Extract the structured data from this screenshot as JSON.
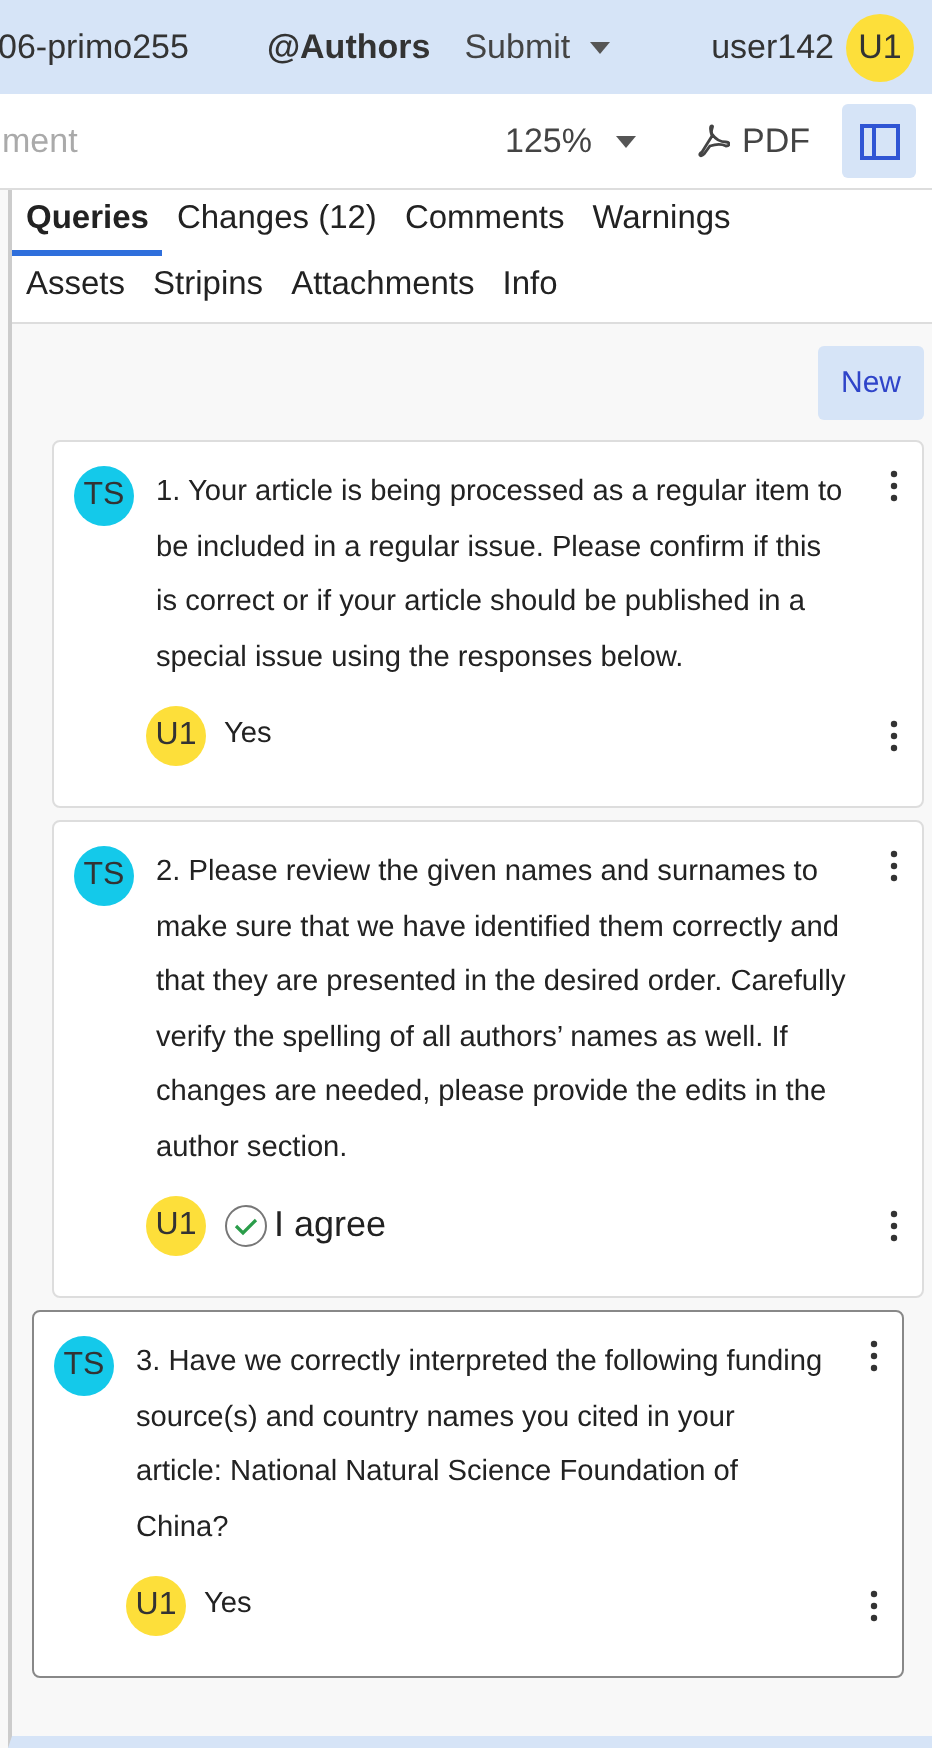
{
  "header": {
    "document": "06-primo255",
    "group": "@Authors",
    "submit": "Submit",
    "user": "user142",
    "avatar": "U1"
  },
  "toolbar": {
    "search": {
      "placeholder": "ment"
    },
    "zoom": "125%",
    "pdf": "PDF",
    "panel_toggle": {
      "on": true
    }
  },
  "tabs": [
    {
      "label": "Queries",
      "selected": true
    },
    {
      "label": "Changes (12)",
      "selected": false
    },
    {
      "label": "Comments",
      "selected": false
    },
    {
      "label": "Warnings",
      "selected": false
    },
    {
      "label": "Assets",
      "selected": false
    },
    {
      "label": "Stripins",
      "selected": false
    },
    {
      "label": "Attachments",
      "selected": false
    },
    {
      "label": "Info",
      "selected": false
    }
  ],
  "new_button": "New",
  "queries": [
    {
      "avatar": "TS",
      "text": "1. Your article is being processed as a regular item to be included in a regular issue. Please confirm if this is correct or if your article should be published in a special issue using the responses below.",
      "selected": false,
      "reply": {
        "kind": "text",
        "avatar": "U1",
        "text": "Yes"
      }
    },
    {
      "avatar": "TS",
      "text": "2. Please review the given names and surnames to make sure that we have identified them correctly and that they are presented in the desired order. Carefully verify the spelling of all authors’ names as well. If changes are needed, please provide the edits in the author section.",
      "selected": false,
      "reply": {
        "kind": "agree",
        "avatar": "U1",
        "text": "I agree"
      }
    },
    {
      "avatar": "TS",
      "text": "3. Have we correctly interpreted the following funding source(s) and country names you cited in your article: National Natural Science Foundation of China?",
      "selected": true,
      "reply": {
        "kind": "text",
        "avatar": "U1",
        "text": "Yes"
      }
    }
  ]
}
